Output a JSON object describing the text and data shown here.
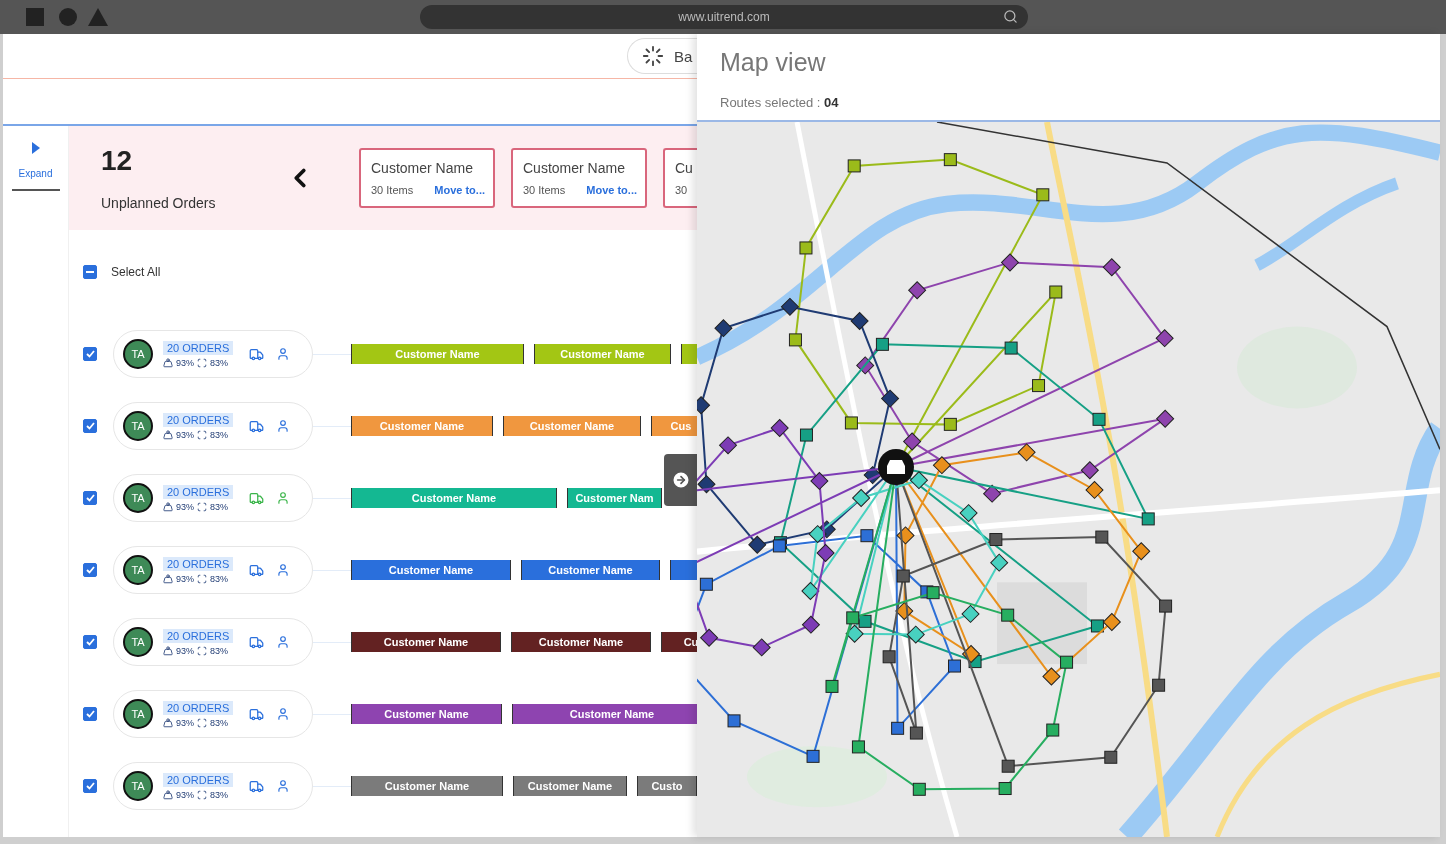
{
  "browser": {
    "url": "www.uitrend.com"
  },
  "toolbar": {
    "button_label": "Ba"
  },
  "sidebar": {
    "expand_label": "Expand"
  },
  "summary": {
    "count": "12",
    "label": "Unplanned Orders"
  },
  "customer_cards": [
    {
      "name": "Customer Name",
      "items": "30 Items",
      "link": "Move to..."
    },
    {
      "name": "Customer Name",
      "items": "30 Items",
      "link": "Move to..."
    },
    {
      "name": "Cu",
      "items": "30"
    }
  ],
  "select_all": {
    "label": "Select All",
    "checked": true,
    "indeterminate": true
  },
  "routes": [
    {
      "checked": true,
      "initials": "TA",
      "orders": "20 ORDERS",
      "weight": "93%",
      "volume": "83%",
      "highlighted": false,
      "color": "#a3c614",
      "trailing_stub": true,
      "segments": [
        {
          "label": "Customer Name"
        },
        {
          "label": "Customer Name"
        }
      ]
    },
    {
      "checked": true,
      "initials": "TA",
      "orders": "20 ORDERS",
      "weight": "93%",
      "volume": "83%",
      "highlighted": false,
      "color": "#f0973f",
      "segments": [
        {
          "label": "Customer Name"
        },
        {
          "label": "Customer Name"
        },
        {
          "label": "Cus"
        }
      ]
    },
    {
      "checked": true,
      "initials": "TA",
      "orders": "20 ORDERS",
      "weight": "93%",
      "volume": "83%",
      "highlighted": true,
      "color": "#14b892",
      "segments": [
        {
          "label": "Customer Name"
        },
        {
          "label": "Customer Nam"
        }
      ]
    },
    {
      "checked": true,
      "initials": "TA",
      "orders": "20 ORDERS",
      "weight": "93%",
      "volume": "83%",
      "highlighted": false,
      "color": "#2a6fdc",
      "trailing_stub": true,
      "segments": [
        {
          "label": "Customer Name"
        },
        {
          "label": "Customer Name"
        }
      ]
    },
    {
      "checked": true,
      "initials": "TA",
      "orders": "20 ORDERS",
      "weight": "93%",
      "volume": "83%",
      "highlighted": false,
      "color": "#632222",
      "segments": [
        {
          "label": "Customer Name"
        },
        {
          "label": "Customer Name"
        },
        {
          "label": "Cu"
        }
      ]
    },
    {
      "checked": true,
      "initials": "TA",
      "orders": "20 ORDERS",
      "weight": "93%",
      "volume": "83%",
      "highlighted": false,
      "color": "#8e44b0",
      "segments": [
        {
          "label": "Customer Name"
        },
        {
          "label": "Customer Name"
        }
      ]
    },
    {
      "checked": true,
      "initials": "TA",
      "orders": "20 ORDERS",
      "weight": "93%",
      "volume": "83%",
      "highlighted": false,
      "color": "#7b7b7b",
      "segments": [
        {
          "label": "Customer Name"
        },
        {
          "label": "Customer Name"
        },
        {
          "label": "Custo"
        }
      ]
    }
  ],
  "map_view": {
    "title": "Map view",
    "routes_selected": "Routes selected : **04**"
  }
}
